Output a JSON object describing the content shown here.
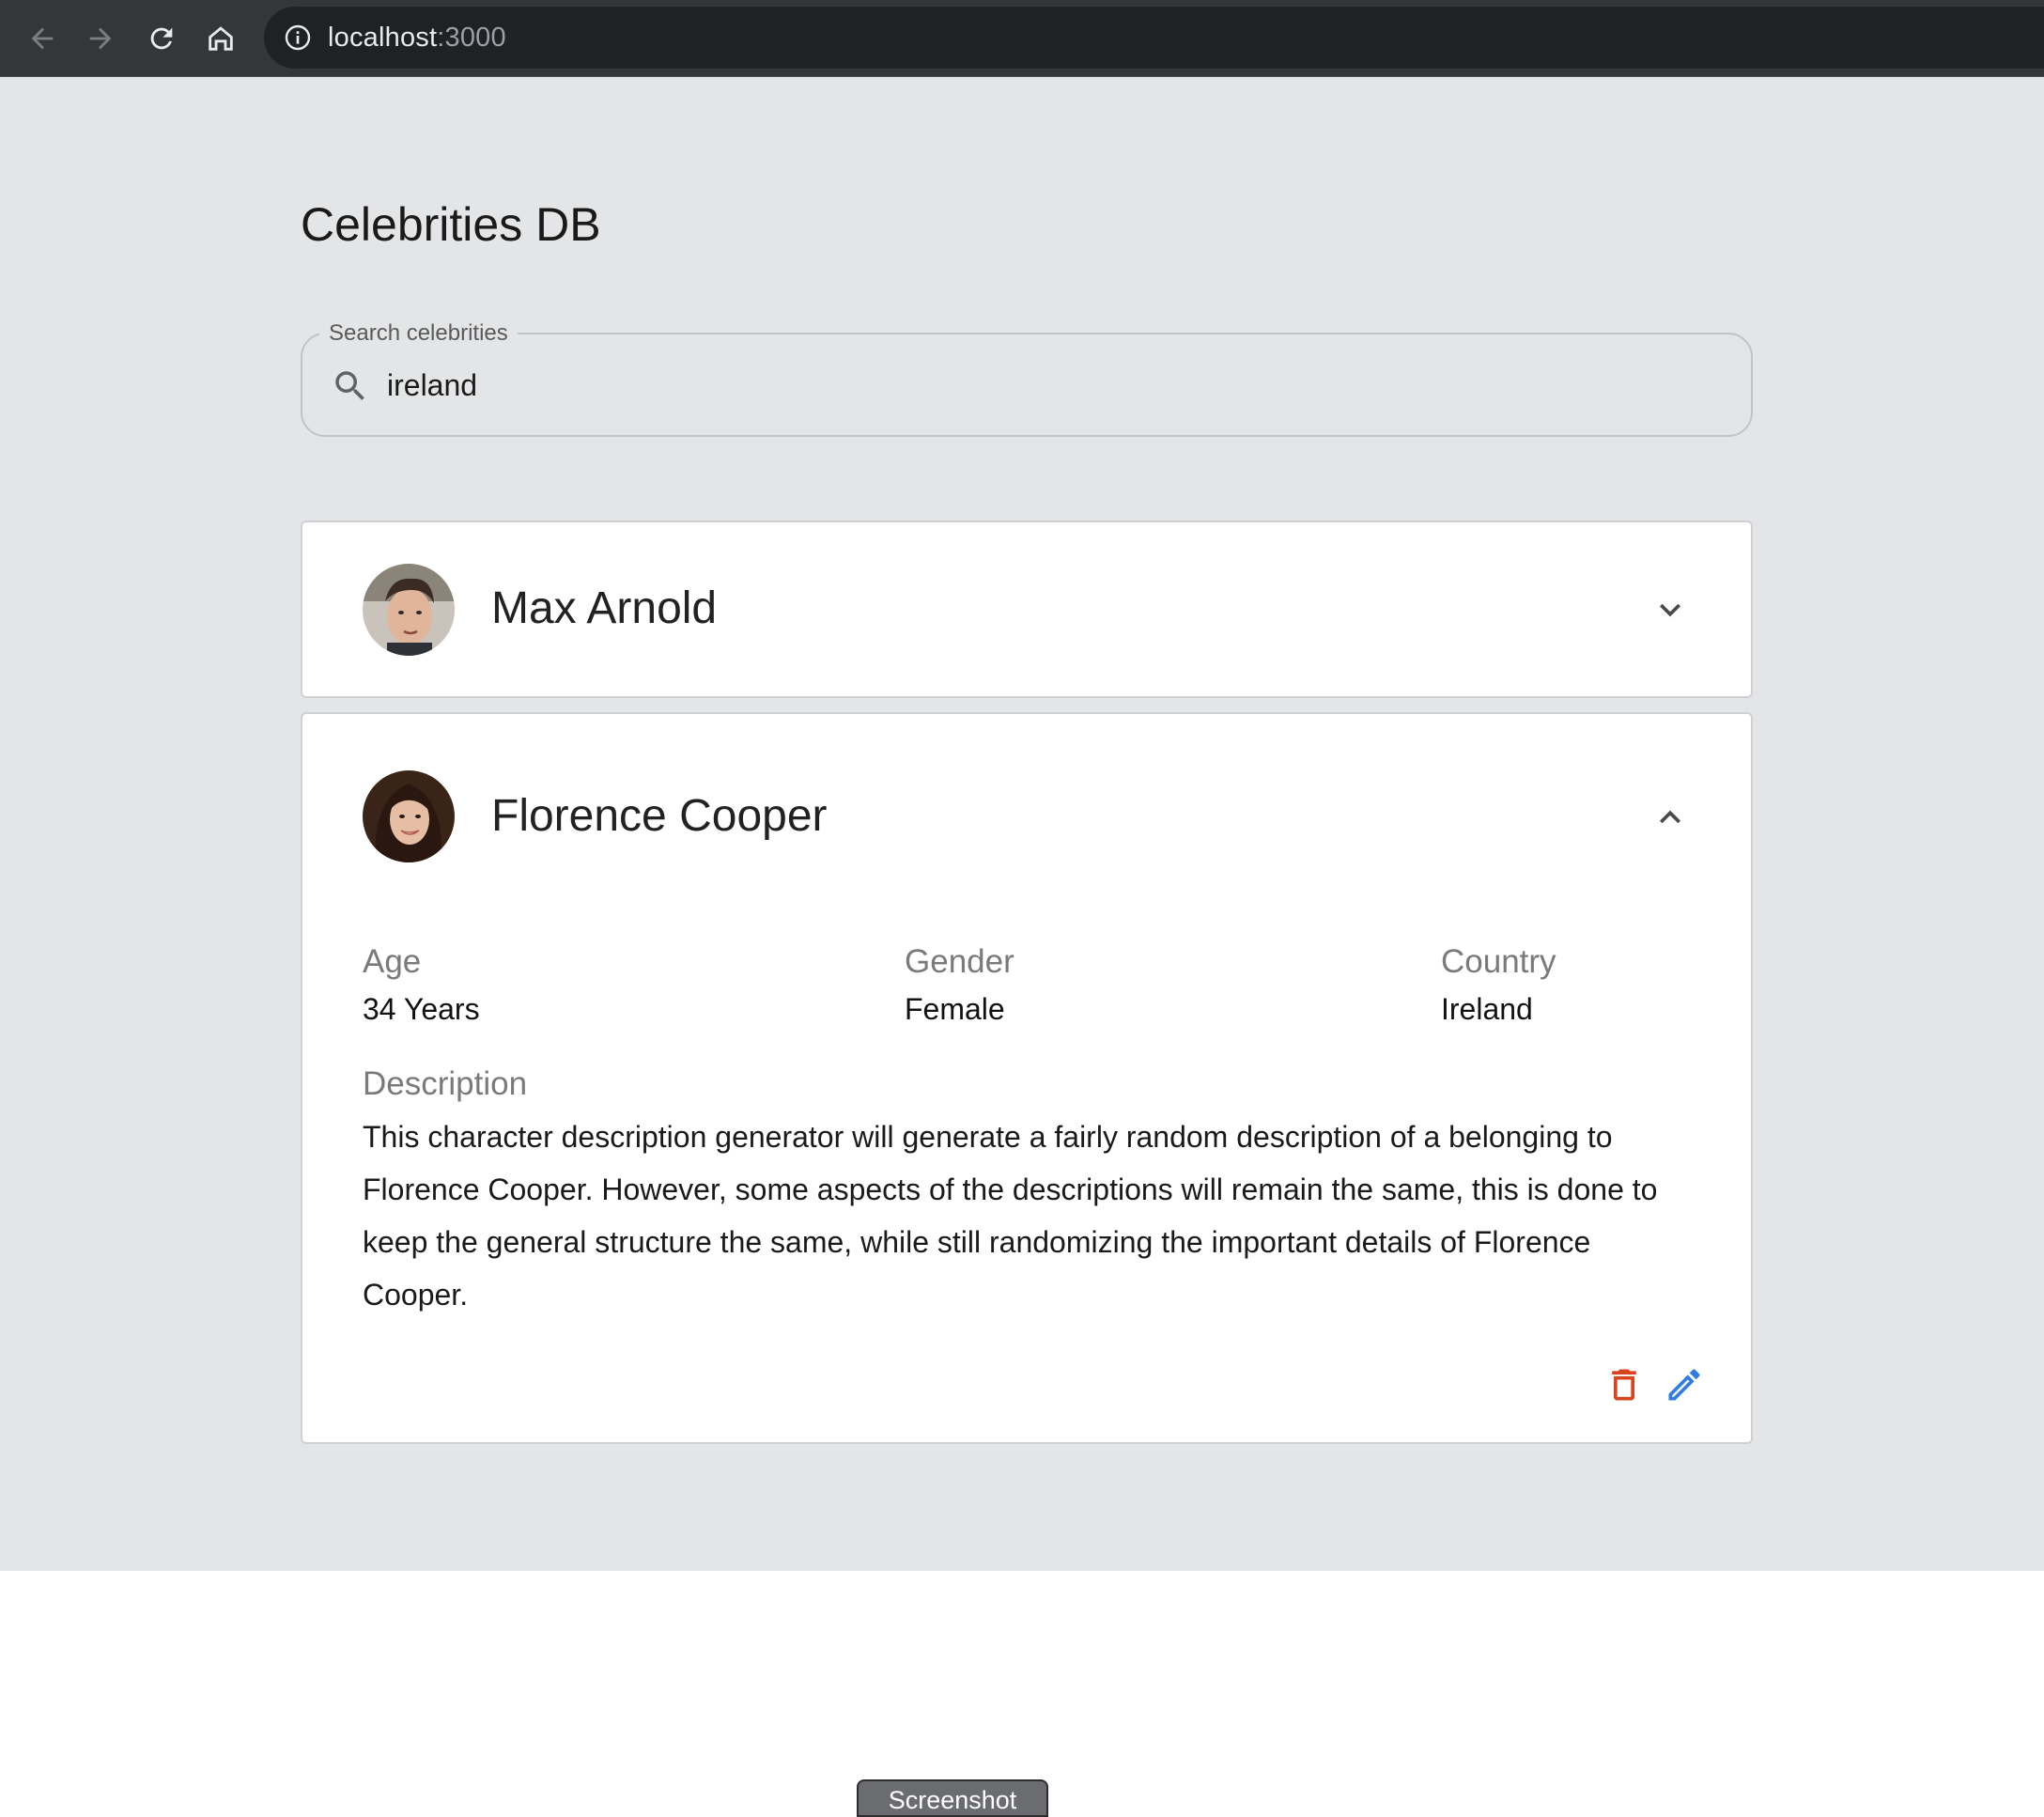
{
  "browser": {
    "url_host": "localhost",
    "url_port": ":3000",
    "icons": [
      "back-arrow-icon",
      "forward-arrow-icon",
      "reload-icon",
      "home-icon",
      "info-icon"
    ]
  },
  "app": {
    "title": "Celebrities DB"
  },
  "search": {
    "label": "Search celebrities",
    "value": "ireland",
    "icon": "search-icon"
  },
  "celebrities": [
    {
      "name": "Max Arnold",
      "expanded": false,
      "chevron": "chevron-down-icon"
    },
    {
      "name": "Florence Cooper",
      "expanded": true,
      "chevron": "chevron-up-icon",
      "labels": {
        "age": "Age",
        "gender": "Gender",
        "country": "Country",
        "description": "Description"
      },
      "age": "34 Years",
      "gender": "Female",
      "country": "Ireland",
      "description": "This character description generator will generate a fairly random description of a belonging to Florence Cooper. However, some aspects of the descriptions will remain the same, this is done to keep the general structure the same, while still randomizing the important details of Florence Cooper.",
      "actions": {
        "delete_icon": "trash-icon",
        "edit_icon": "pencil-icon"
      }
    }
  ],
  "footer": {
    "screenshot_label": "Screenshot"
  },
  "colors": {
    "page_background": "#e4e5e7",
    "delete": "#d9441f",
    "edit": "#2f7de1",
    "chrome": "#35363a"
  }
}
